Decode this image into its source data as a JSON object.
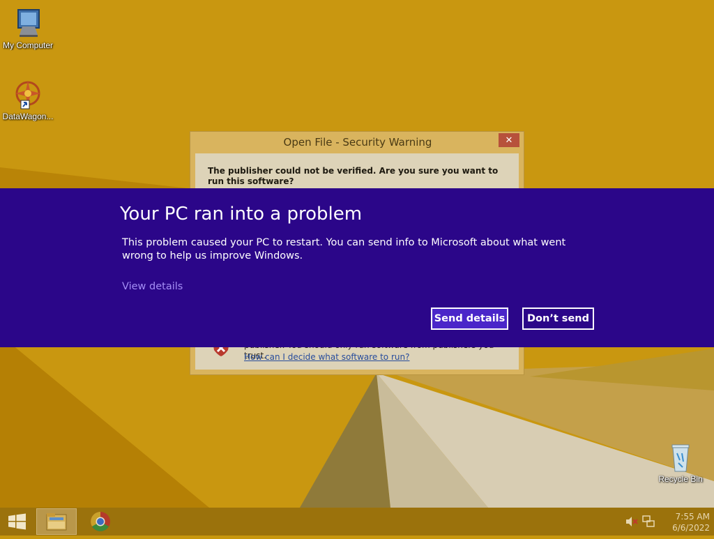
{
  "desktop": {
    "icons": [
      {
        "label": "My Computer",
        "icon": "computer-icon"
      },
      {
        "label": "DataWagon...",
        "icon": "datawagon-app-icon"
      },
      {
        "label": "Recycle Bin",
        "icon": "recycle-bin-icon"
      }
    ]
  },
  "security_dialog": {
    "title": "Open File - Security Warning",
    "close_label": "✕",
    "message": "The publisher could not be verified.  Are you sure you want to run this software?",
    "warning_text": "publisher.  You should only run software from publishers you trust.",
    "help_link": "How can I decide what software to run?"
  },
  "error_banner": {
    "title": "Your PC ran into a problem",
    "message": "This problem caused your PC to restart. You can send info to Microsoft about what went wrong to help us improve Windows.",
    "view_details": "View details",
    "send_button": "Send details",
    "dont_send_button": "Don’t send",
    "background_color": "#2b0689"
  },
  "taskbar": {
    "pinned": [
      {
        "icon": "file-explorer-icon"
      },
      {
        "icon": "chrome-icon"
      }
    ],
    "clock": {
      "time": "7:55 AM",
      "date": "6/6/2022"
    }
  }
}
